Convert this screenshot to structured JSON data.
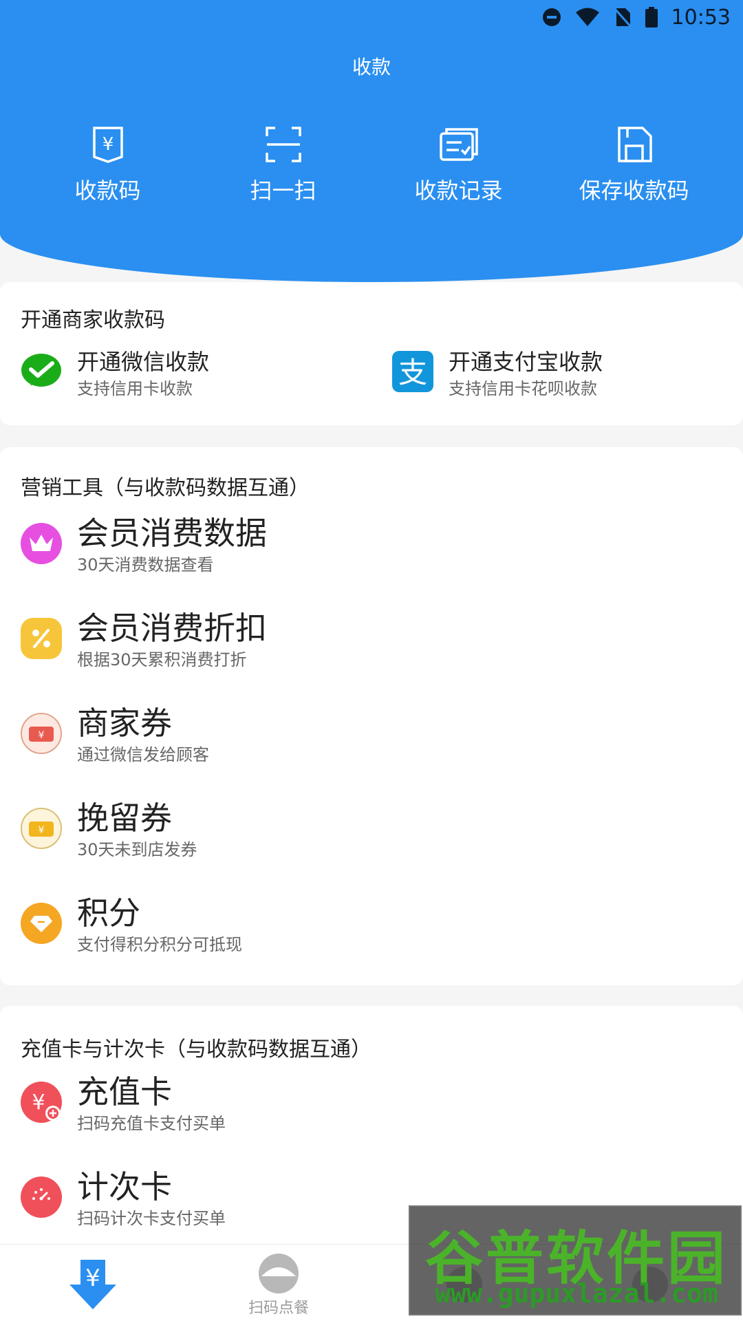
{
  "status_bar": {
    "time": "10:53",
    "icons": [
      "dnd-icon",
      "wifi-icon",
      "no-sim-icon",
      "battery-icon"
    ]
  },
  "header": {
    "title": "收款",
    "actions": [
      {
        "label": "收款码",
        "icon": "receipt-code-icon"
      },
      {
        "label": "扫一扫",
        "icon": "scan-icon"
      },
      {
        "label": "收款记录",
        "icon": "records-icon"
      },
      {
        "label": "保存收款码",
        "icon": "save-icon"
      }
    ]
  },
  "merchant_section": {
    "title": "开通商家收款码",
    "items": [
      {
        "main": "开通微信收款",
        "sub": "支持信用卡收款",
        "icon": "wechat-pay-icon"
      },
      {
        "main": "开通支付宝收款",
        "sub": "支持信用卡花呗收款",
        "icon": "alipay-icon"
      }
    ]
  },
  "marketing_section": {
    "title": "营销工具（与收款码数据互通）",
    "items": [
      {
        "main": "会员消费数据",
        "sub": "30天消费数据查看",
        "icon": "crown-icon",
        "color": "#e64fe0"
      },
      {
        "main": "会员消费折扣",
        "sub": "根据30天累积消费打折",
        "icon": "discount-icon",
        "color": "#f7c53a"
      },
      {
        "main": "商家券",
        "sub": "通过微信发给顾客",
        "icon": "merchant-coupon-icon",
        "color": "#e85a4f"
      },
      {
        "main": "挽留券",
        "sub": "30天未到店发券",
        "icon": "retention-coupon-icon",
        "color": "#f2b51c"
      },
      {
        "main": "积分",
        "sub": "支付得积分积分可抵现",
        "icon": "points-icon",
        "color": "#f5a623"
      }
    ]
  },
  "card_section": {
    "title": "充值卡与计次卡（与收款码数据互通）",
    "items": [
      {
        "main": "充值卡",
        "sub": "扫码充值卡支付买单",
        "icon": "recharge-card-icon",
        "color": "#f0505a"
      },
      {
        "main": "计次卡",
        "sub": "扫码计次卡支付买单",
        "icon": "count-card-icon",
        "color": "#f0505a"
      }
    ]
  },
  "bottom_nav": [
    {
      "label": "",
      "icon": "collect-payment-icon",
      "active": true
    },
    {
      "label": "扫码点餐",
      "icon": "dining-icon",
      "active": false
    },
    {
      "label": "",
      "icon": "nav-item-3-icon",
      "active": false
    },
    {
      "label": "",
      "icon": "nav-item-4-icon",
      "active": false
    }
  ],
  "watermark": {
    "brand": "谷普软件园",
    "url": "www.gupuxlazal.com"
  },
  "colors": {
    "primary": "#2a8ff0",
    "wechat": "#1aad19",
    "alipay": "#1296db"
  }
}
